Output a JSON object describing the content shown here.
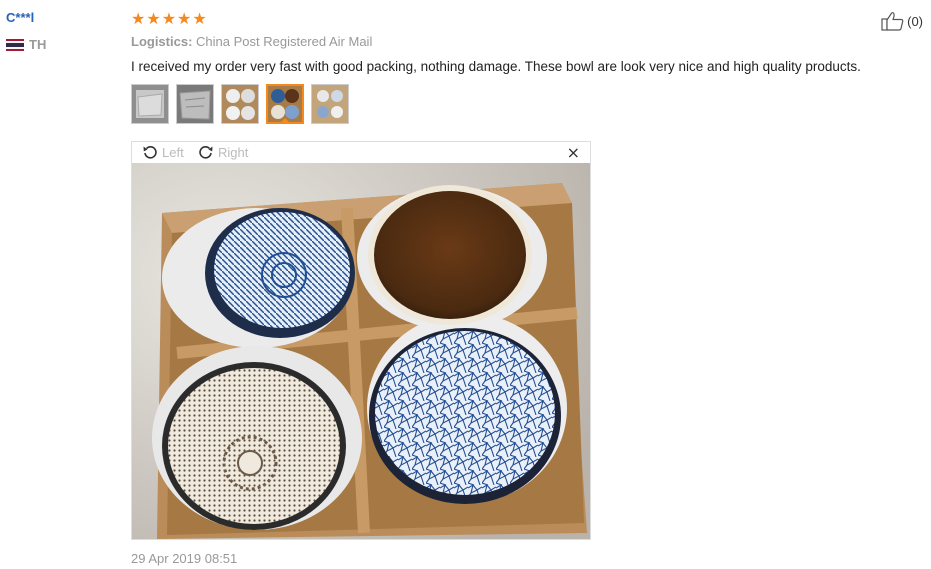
{
  "user": {
    "name": "C***l",
    "country_code": "TH"
  },
  "review": {
    "rating": 5,
    "stars": [
      "★",
      "★",
      "★",
      "★",
      "★"
    ],
    "logistics_label": "Logistics:",
    "logistics_value": "China Post Registered Air Mail",
    "text": "I received my order very fast with good packing, nothing damage. These bowl are look very nice and high quality products.",
    "date": "29 Apr 2019 08:51"
  },
  "helpful": {
    "count": "(0)",
    "icon": "thumbs-up-icon"
  },
  "viewer": {
    "rotate_left_label": "Left",
    "rotate_right_label": "Right",
    "close_label": "×"
  },
  "colors": {
    "accent": "#f4891d",
    "username": "#2662b8",
    "muted": "#999999"
  }
}
